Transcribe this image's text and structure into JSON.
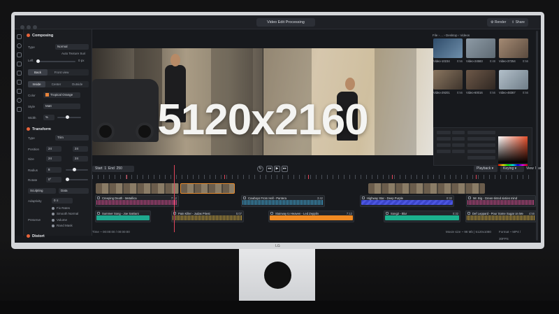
{
  "window": {
    "title": "Video Edit Processing",
    "render_label": "Render",
    "share_label": "Share"
  },
  "breadcrumb": "File › ... › Desktop › Videos",
  "monitor_brand": "LG",
  "composing": {
    "title": "Composing",
    "type_label": "Type",
    "type_value": "Normal",
    "auto_texture": "Auto Texture Suri",
    "left_label": "Left",
    "left_value": "0 px",
    "tabs": [
      "Back",
      "Front view"
    ],
    "mode_tabs": [
      "Inside",
      "Center",
      "Outside"
    ],
    "color_label": "Color",
    "color_value": "Tropical Orange",
    "style_label": "Style",
    "style_value": "Matt",
    "width_label": "Width",
    "width_value": "%"
  },
  "transform": {
    "title": "Transform",
    "type_label": "Type",
    "type_value": "Trim",
    "position_label": "Position",
    "position_x": "24",
    "position_y": "24",
    "size_label": "Size",
    "size_x": "24",
    "size_y": "24",
    "radius_label": "Radius",
    "radius_value": "8",
    "rotate_label": "Rotate",
    "rotate_value": "0°",
    "sculpting_label": "Sculpting",
    "sculpting_value": "Data",
    "adaptivity_label": "Adaptivity",
    "adaptivity_value": "0 ≡",
    "adaptivity_options": [
      "Fix Rates",
      "Smooth Normal"
    ],
    "preserve_label": "Preserve",
    "preserve_options": [
      "Volume",
      "Rand Mask"
    ]
  },
  "distort": {
    "title": "Distort"
  },
  "preview": {
    "overlay_text": "5120x2160"
  },
  "thumbnails": [
    {
      "name": "Video-10234",
      "duration": "0:56",
      "color": "#4a6b8a"
    },
    {
      "name": "Video-24583",
      "duration": "0:48",
      "color": "#7a8c99"
    },
    {
      "name": "Video-37254",
      "duration": "0:56",
      "color": "#8a6e5c"
    },
    {
      "name": "Video-29201",
      "duration": "0:56",
      "color": "#6e5e4e"
    },
    {
      "name": "Video-60016",
      "duration": "0:56",
      "color": "#5b4a40"
    },
    {
      "name": "Video-48367",
      "duration": "0:56",
      "color": "#8b9aa6"
    }
  ],
  "transport": {
    "start_label": "Start",
    "start_value": "1",
    "end_label": "End",
    "end_value": "250",
    "playback_label": "Playback",
    "keying_label": "Keying",
    "view_label": "View",
    "marker_label": "Marker"
  },
  "tracks": [
    {
      "title": "Creeping Death - Metallica",
      "duration": "7:12",
      "style": "wave",
      "color": "#d24a8c"
    },
    {
      "title": "Cowboys From Hell - Pantera",
      "duration": "3:42",
      "style": "wave",
      "color": "#3fa9d8"
    },
    {
      "title": "Highway Star - Deep Purple",
      "duration": "0:32",
      "style": "stripes",
      "color": "#4d57e0"
    },
    {
      "title": "Mr. Big - Green-tinted sixties mind",
      "duration": "",
      "style": "wave",
      "color": "#d24a8c"
    },
    {
      "title": "Summer Song - Joe Satriani",
      "duration": "",
      "style": "solid",
      "color": "#1ea88f"
    },
    {
      "title": "Pain Killer - Judas Priest",
      "duration": "5:07",
      "style": "wave",
      "color": "#c9a23a"
    },
    {
      "title": "Stairway to Heaven - Led Zepplin",
      "duration": "7:12",
      "style": "solid",
      "color": "#f08a22"
    },
    {
      "title": "Song2 - Blur",
      "duration": "0:32",
      "style": "solid",
      "color": "#1bb08d"
    },
    {
      "title": "Def Leppard - Pour Some Sugar on Me",
      "duration": "4:56",
      "style": "wave",
      "color": "#c9a23a"
    }
  ],
  "status": {
    "time": "Time ~ 00:00:00 / 00:00:00",
    "movie_size": "Movie size ~ 98 Mb | 5120x1080",
    "format": "Format ~ MP4 / 30FPS"
  }
}
